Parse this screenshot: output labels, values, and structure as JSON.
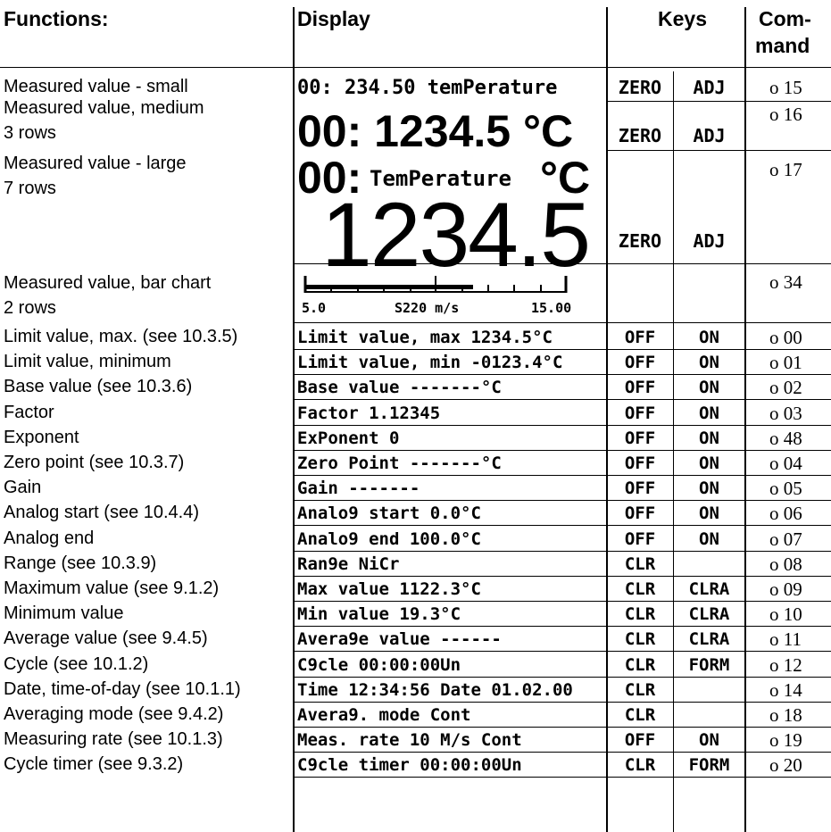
{
  "headers": {
    "functions": "Functions:",
    "display": "Display",
    "keys": "Keys",
    "command_line1": "Com-",
    "command_line2": "mand"
  },
  "special_rows": {
    "small": {
      "function": "Measured value - small",
      "display": "00: 234.50  temPerature",
      "key1": "ZERO",
      "key2": "ADJ",
      "command": "o 15"
    },
    "medium": {
      "function_line1": "Measured value, medium",
      "function_line2": " 3 rows",
      "display": "00: 1234.5 °C",
      "key1": "ZERO",
      "key2": "ADJ",
      "command": "o 16"
    },
    "large": {
      "function_line1": "Measured value - large",
      "function_line2": " 7 rows",
      "display_prefix": "00:",
      "display_label": "TemPerature",
      "display_unit": "°C",
      "display_value": "1234.5",
      "key1": "ZERO",
      "key2": "ADJ",
      "command": "o 17"
    },
    "bar": {
      "function_line1": "Measured value, bar chart",
      "function_line2": "2 rows",
      "label_left": "5.0",
      "label_mid": "S220 m/s",
      "label_right": "15.00",
      "command": "o 34"
    }
  },
  "rows": [
    {
      "function": "Limit value, max. (see 10.3.5)",
      "display": "Limit value, max    1234.5°C",
      "key1": "OFF",
      "key2": "ON",
      "command": "o 00"
    },
    {
      "function": "Limit value, minimum",
      "display": "Limit value, min  -0123.4°C",
      "key1": "OFF",
      "key2": "ON",
      "command": "o 01"
    },
    {
      "function": "Base value (see 10.3.6)",
      "display": "Base value       -------°C",
      "key1": "OFF",
      "key2": "ON",
      "command": "o 02"
    },
    {
      "function": "Factor",
      "display": "Factor        1.12345",
      "key1": "OFF",
      "key2": "ON",
      "command": "o 03"
    },
    {
      "function": "Exponent",
      "display": "ExPonent                 0",
      "key1": "OFF",
      "key2": "ON",
      "command": "o 48"
    },
    {
      "function": "Zero point (see 10.3.7)",
      "display": "Zero Point       -------°C",
      "key1": "OFF",
      "key2": "ON",
      "command": "o 04"
    },
    {
      "function": "Gain",
      "display": "Gain      -------",
      "key1": "OFF",
      "key2": "ON",
      "command": "o 05"
    },
    {
      "function": "Analog start (see 10.4.4)",
      "display": "Analo9 start     0.0°C",
      "key1": "OFF",
      "key2": "ON",
      "command": "o 06"
    },
    {
      "function": "Analog end",
      "display": "Analo9 end     100.0°C",
      "key1": "OFF",
      "key2": "ON",
      "command": "o 07"
    },
    {
      "function": "Range (see 10.3.9)",
      "display": "Ran9e           NiCr",
      "key1": "CLR",
      "key2": "",
      "command": "o 08"
    },
    {
      "function": "Maximum value (see 9.1.2)",
      "display": "Max value        1122.3°C",
      "key1": "CLR",
      "key2": "CLRA",
      "command": "o 09"
    },
    {
      "function": "Minimum value",
      "display": "Min value          19.3°C",
      "key1": "CLR",
      "key2": "CLRA",
      "command": "o 10"
    },
    {
      "function": "Average value (see 9.4.5)",
      "display": "Avera9e value   ------",
      "key1": "CLR",
      "key2": "CLRA",
      "command": "o 11"
    },
    {
      "function": "Cycle (see 10.1.2)",
      "display": "C9cle        00:00:00Un",
      "key1": "CLR",
      "key2": "FORM",
      "command": "o 12"
    },
    {
      "function": "Date, time-of-day (see 10.1.1)",
      "display": "Time 12:34:56  Date 01.02.00",
      "key1": "CLR",
      "key2": "",
      "command": "o 14"
    },
    {
      "function": "Averaging mode (see 9.4.2)",
      "display": "Avera9. mode   Cont",
      "key1": "CLR",
      "key2": "",
      "command": "o 18"
    },
    {
      "function": "Measuring rate (see 10.1.3)",
      "display": "Meas. rate 10 M/s  Cont",
      "key1": "OFF",
      "key2": "ON",
      "command": "o 19"
    },
    {
      "function": "Cycle timer (see 9.3.2)",
      "display": "C9cle timer 00:00:00Un",
      "key1": "CLR",
      "key2": "FORM",
      "command": "o 20"
    }
  ]
}
